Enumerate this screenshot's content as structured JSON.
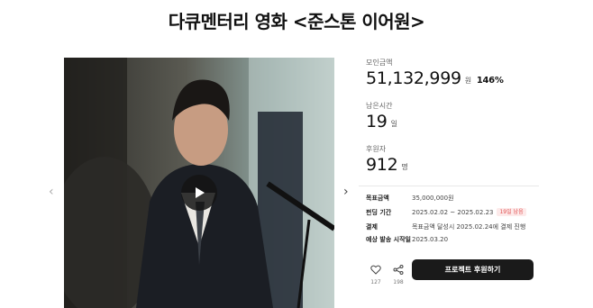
{
  "page": {
    "title": "다큐멘터리 영화 <준스톤 이어원>"
  },
  "stats": {
    "funding": {
      "label": "모인금액",
      "value": "51,132,999",
      "unit": "원",
      "percent": "146%"
    },
    "time_left": {
      "label": "남은시간",
      "value": "19",
      "unit": "일"
    },
    "backers": {
      "label": "후원자",
      "value": "912",
      "unit": "명"
    }
  },
  "info": [
    {
      "key": "목표금액",
      "value": "35,000,000원"
    },
    {
      "key": "펀딩 기간",
      "value": "2025.02.02 ~ 2025.02.23",
      "badge": "19일 남음"
    },
    {
      "key": "결제",
      "value": "목표금액 달성시 2025.02.24에 결제 진행"
    },
    {
      "key": "예상 발송 시작일",
      "value": "2025.03.20"
    }
  ],
  "actions": {
    "like_count": "127",
    "share_count": "198",
    "cta_label": "프로젝트 후원하기"
  },
  "colors": {
    "cta_background": "#1a1a1a",
    "badge_background": "#fdeaea",
    "badge_text": "#e05050"
  },
  "icons": {
    "carousel_prev": "chevron-left-icon",
    "carousel_next": "chevron-right-icon",
    "play": "play-icon",
    "like": "heart-icon",
    "share": "share-icon"
  }
}
